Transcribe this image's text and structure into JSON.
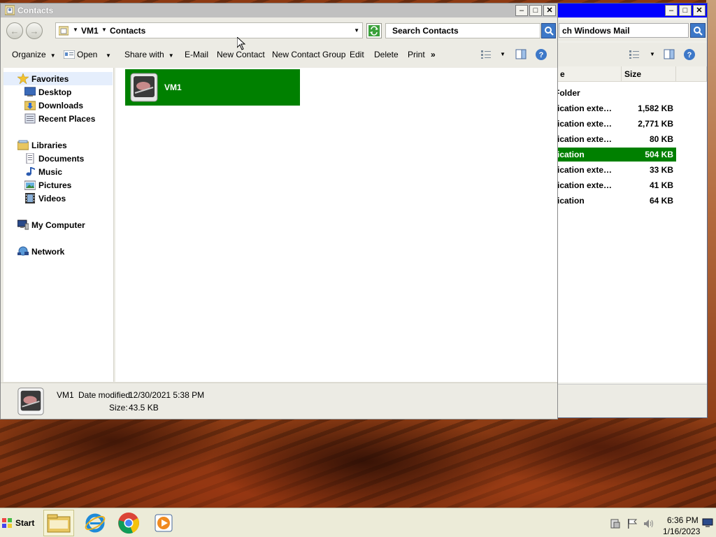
{
  "mail_window": {
    "search_placeholder": "ch Windows Mail",
    "columns": {
      "name": "e",
      "size": "Size"
    },
    "rows": [
      {
        "name": "older",
        "size": ""
      },
      {
        "name": "ication exte…",
        "size": "1,582 KB"
      },
      {
        "name": "ication exte…",
        "size": "2,771 KB"
      },
      {
        "name": "ication exte…",
        "size": "80 KB"
      },
      {
        "name": "ication",
        "size": "504 KB"
      },
      {
        "name": "ication exte…",
        "size": "33 KB"
      },
      {
        "name": "ication exte…",
        "size": "41 KB"
      },
      {
        "name": "ication",
        "size": "64 KB"
      }
    ],
    "first_row_name": "Folder"
  },
  "window": {
    "title": "Contacts",
    "breadcrumb": [
      "VM1",
      "Contacts"
    ],
    "search_placeholder": "Search Contacts"
  },
  "toolbar": {
    "organize": "Organize",
    "open": "Open",
    "share_with": "Share with",
    "email": "E-Mail",
    "new_contact": "New Contact",
    "new_contact_group": "New Contact Group",
    "edit": "Edit",
    "delete": "Delete",
    "print": "Print",
    "more": "»"
  },
  "nav": {
    "favorites": "Favorites",
    "desktop": "Desktop",
    "downloads": "Downloads",
    "recent_places": "Recent Places",
    "libraries": "Libraries",
    "documents": "Documents",
    "music": "Music",
    "pictures": "Pictures",
    "videos": "Videos",
    "my_computer": "My Computer",
    "network": "Network"
  },
  "files": [
    {
      "name": "VM1"
    }
  ],
  "details": {
    "name": "VM1",
    "date_label": "Date modified:",
    "date_value": "12/30/2021 5:38 PM",
    "size_label": "Size:",
    "size_value": "43.5 KB"
  },
  "taskbar": {
    "start": "Start",
    "time": "6:36 PM",
    "date": "1/16/2023"
  },
  "colors": {
    "selection": "#008000",
    "mail_title": "#0000ff"
  }
}
